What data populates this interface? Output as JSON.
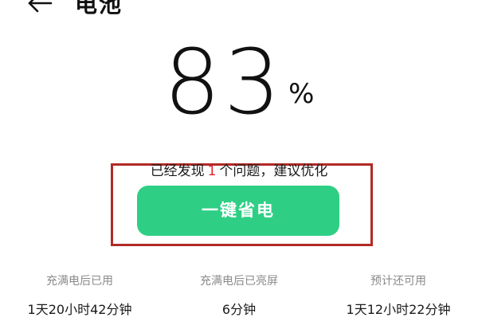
{
  "header": {
    "title": "电池",
    "back_icon": "arrow-left-icon"
  },
  "battery": {
    "level": "83",
    "unit": "%"
  },
  "issue": {
    "prefix": "已经发现",
    "count": "1",
    "suffix": "个问题，建议优化"
  },
  "optimize_button": {
    "label": "一键省电",
    "color": "#2ecf85"
  },
  "highlight_color": "#b12a26",
  "stats": [
    {
      "label": "充满电后已用",
      "value": "1天20小时42分钟"
    },
    {
      "label": "充满电后已亮屏",
      "value": "6分钟"
    },
    {
      "label": "预计还可用",
      "value": "1天12小时22分钟"
    }
  ]
}
